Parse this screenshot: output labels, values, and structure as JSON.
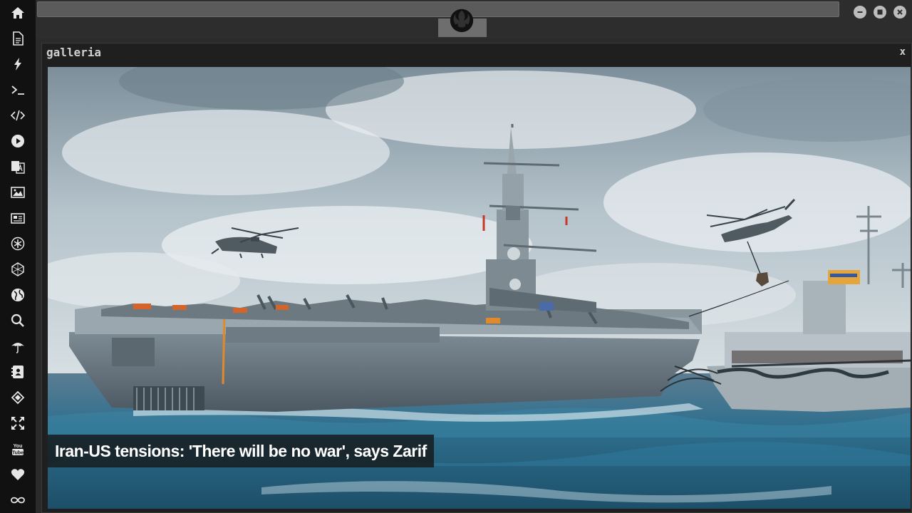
{
  "topbar": {
    "logo_icon": "rebel-alliance-icon",
    "window_controls": [
      "minimize-icon",
      "maximize-icon",
      "close-icon"
    ]
  },
  "sidebar": {
    "items": [
      {
        "icon": "home-icon"
      },
      {
        "icon": "document-icon"
      },
      {
        "icon": "lightning-icon"
      },
      {
        "icon": "terminal-icon"
      },
      {
        "icon": "code-icon"
      },
      {
        "icon": "play-icon"
      },
      {
        "icon": "translate-icon"
      },
      {
        "icon": "image-icon"
      },
      {
        "icon": "newspaper-icon"
      },
      {
        "icon": "asterisk-icon"
      },
      {
        "icon": "network-icon"
      },
      {
        "icon": "globe-icon"
      },
      {
        "icon": "search-icon"
      },
      {
        "icon": "umbrella-icon"
      },
      {
        "icon": "contacts-icon"
      },
      {
        "icon": "connect-icon"
      },
      {
        "icon": "expand-icon"
      },
      {
        "icon": "youtube-icon"
      },
      {
        "icon": "heart-icon"
      },
      {
        "icon": "infinity-icon"
      }
    ]
  },
  "panel": {
    "title": "galleria",
    "close_label": "x"
  },
  "gallery": {
    "image_icon": "photo-aircraft-carrier",
    "caption": "Iran-US tensions: 'There will be no war', says Zarif"
  }
}
